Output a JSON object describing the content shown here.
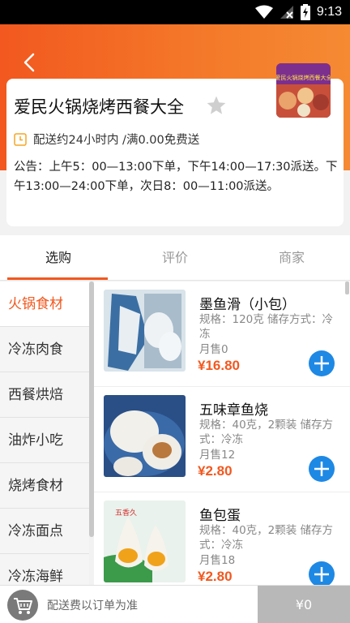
{
  "status_bar": {
    "time": "9:13"
  },
  "store": {
    "name": "爱民火锅烧烤西餐大全",
    "logo_text": "爱民火锅烧烤西餐大全",
    "delivery": "配送约24小时内 /满0.00免费送",
    "notice": "公告：上午5：00—13:00下单，下午14:00—17:30派送。下午13:00—24:00下单，次日8：00—11:00派送。"
  },
  "tabs": [
    {
      "label": "选购"
    },
    {
      "label": "评价"
    },
    {
      "label": "商家"
    }
  ],
  "categories": [
    {
      "label": "火锅食材"
    },
    {
      "label": "冷冻肉食"
    },
    {
      "label": "西餐烘焙"
    },
    {
      "label": "油炸小吃"
    },
    {
      "label": "烧烤食材"
    },
    {
      "label": "冷冻面点"
    },
    {
      "label": "冷冻海鲜"
    }
  ],
  "products": [
    {
      "name": "墨鱼滑（小包）",
      "spec": "规格：120克 储存方式：冷冻",
      "sold": "月售0",
      "price": "¥16.80"
    },
    {
      "name": "五味章鱼烧",
      "spec": "规格：40克，2颗装 储存方式：冷冻",
      "sold": "月售12",
      "price": "¥2.80"
    },
    {
      "name": "鱼包蛋",
      "spec": "规格：40克，2颗装 储存方式：冷冻",
      "sold": "月售18",
      "price": "¥2.80",
      "package_text": "五香久"
    }
  ],
  "cart": {
    "delivery_note": "配送费以订单为准",
    "total": "¥0"
  },
  "colors": {
    "accent": "#f2581f",
    "add_button": "#1e88e5",
    "checkout_bg": "#b8b8b8"
  }
}
